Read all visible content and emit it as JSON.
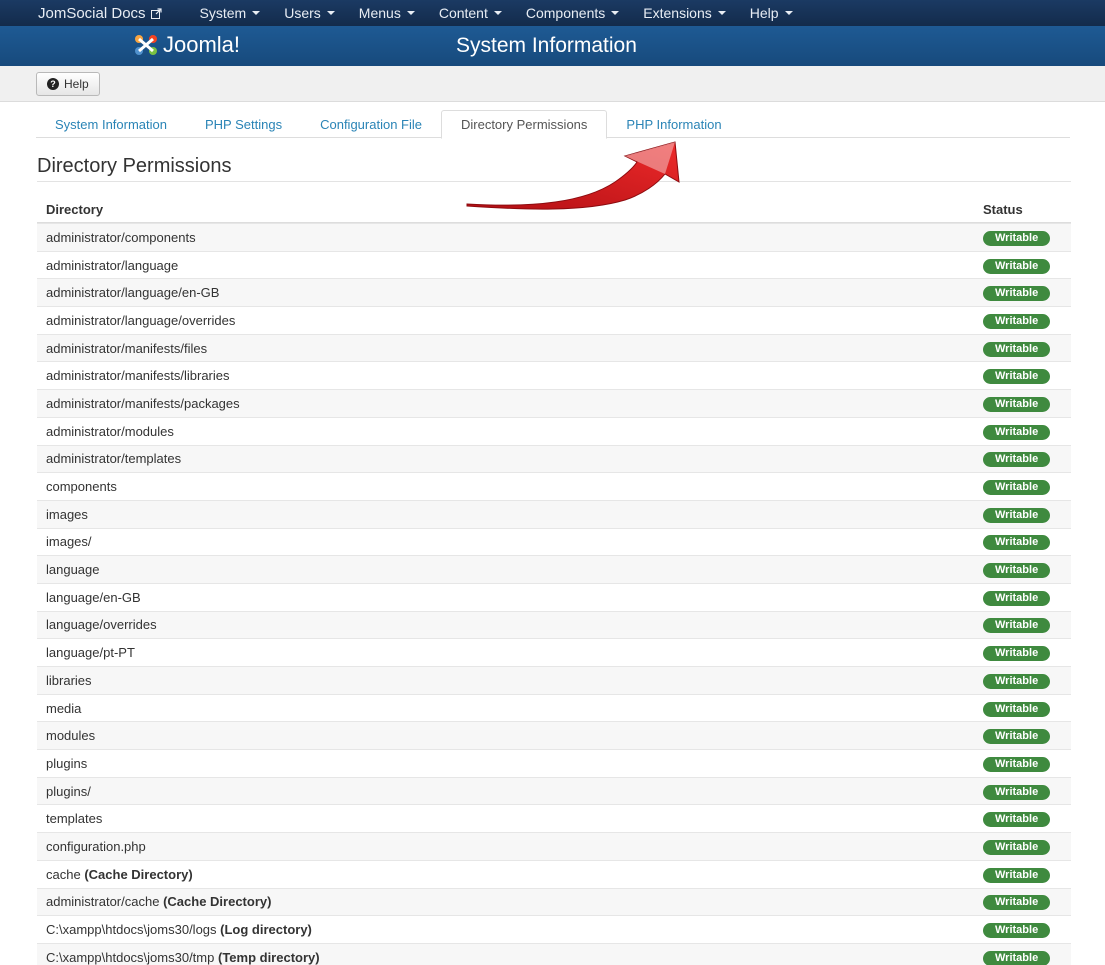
{
  "topnav": {
    "brand": "JomSocial Docs",
    "menus": [
      "System",
      "Users",
      "Menus",
      "Content",
      "Components",
      "Extensions",
      "Help"
    ]
  },
  "header": {
    "logo_text": "Joomla!",
    "title": "System Information"
  },
  "toolbar": {
    "help_label": "Help"
  },
  "tabs": [
    {
      "label": "System Information",
      "active": false
    },
    {
      "label": "PHP Settings",
      "active": false
    },
    {
      "label": "Configuration File",
      "active": false
    },
    {
      "label": "Directory Permissions",
      "active": true
    },
    {
      "label": "PHP Information",
      "active": false
    }
  ],
  "section": {
    "title": "Directory Permissions",
    "col_directory": "Directory",
    "col_status": "Status"
  },
  "rows": [
    {
      "dir": "administrator/components",
      "note": "",
      "status": "Writable"
    },
    {
      "dir": "administrator/language",
      "note": "",
      "status": "Writable"
    },
    {
      "dir": "administrator/language/en-GB",
      "note": "",
      "status": "Writable"
    },
    {
      "dir": "administrator/language/overrides",
      "note": "",
      "status": "Writable"
    },
    {
      "dir": "administrator/manifests/files",
      "note": "",
      "status": "Writable"
    },
    {
      "dir": "administrator/manifests/libraries",
      "note": "",
      "status": "Writable"
    },
    {
      "dir": "administrator/manifests/packages",
      "note": "",
      "status": "Writable"
    },
    {
      "dir": "administrator/modules",
      "note": "",
      "status": "Writable"
    },
    {
      "dir": "administrator/templates",
      "note": "",
      "status": "Writable"
    },
    {
      "dir": "components",
      "note": "",
      "status": "Writable"
    },
    {
      "dir": "images",
      "note": "",
      "status": "Writable"
    },
    {
      "dir": "images/",
      "note": "",
      "status": "Writable"
    },
    {
      "dir": "language",
      "note": "",
      "status": "Writable"
    },
    {
      "dir": "language/en-GB",
      "note": "",
      "status": "Writable"
    },
    {
      "dir": "language/overrides",
      "note": "",
      "status": "Writable"
    },
    {
      "dir": "language/pt-PT",
      "note": "",
      "status": "Writable"
    },
    {
      "dir": "libraries",
      "note": "",
      "status": "Writable"
    },
    {
      "dir": "media",
      "note": "",
      "status": "Writable"
    },
    {
      "dir": "modules",
      "note": "",
      "status": "Writable"
    },
    {
      "dir": "plugins",
      "note": "",
      "status": "Writable"
    },
    {
      "dir": "plugins/",
      "note": "",
      "status": "Writable"
    },
    {
      "dir": "templates",
      "note": "",
      "status": "Writable"
    },
    {
      "dir": "configuration.php",
      "note": "",
      "status": "Writable"
    },
    {
      "dir": "cache",
      "note": "(Cache Directory)",
      "status": "Writable"
    },
    {
      "dir": "administrator/cache",
      "note": "(Cache Directory)",
      "status": "Writable"
    },
    {
      "dir": "C:\\xampp\\htdocs\\joms30/logs",
      "note": "(Log directory)",
      "status": "Writable"
    },
    {
      "dir": "C:\\xampp\\htdocs\\joms30/tmp",
      "note": "(Temp directory)",
      "status": "Writable"
    }
  ],
  "colors": {
    "nav_bg": "#132b4b",
    "header_bg": "#1e5a94",
    "tab_link": "#2a84b6",
    "badge_green": "#3f8a3f",
    "arrow_red": "#d3151a"
  }
}
